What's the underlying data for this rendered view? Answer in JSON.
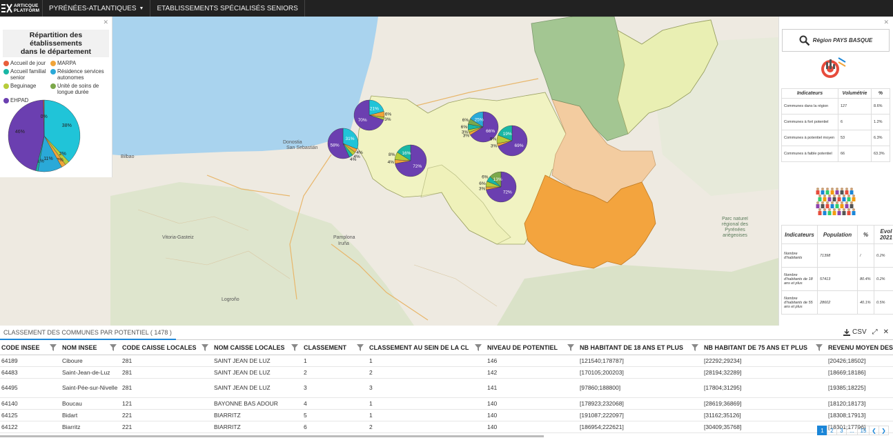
{
  "topbar": {
    "logo_line1": "ARTICQUE",
    "logo_line2": "PLATFORM",
    "dept_menu": "PYRÉNÉES-ATLANTIQUES",
    "module": "ETABLISSEMENTS SPÉCIALISÉS SENIORS"
  },
  "left_panel": {
    "title_line1": "Répartition des établissements",
    "title_line2": "dans le département",
    "legend": [
      {
        "label": "Accueil de jour",
        "color": "#e85f3c"
      },
      {
        "label": "MARPA",
        "color": "#f0a43a"
      },
      {
        "label": "Accueil familial senior",
        "color": "#19b7a5"
      },
      {
        "label": "Résidence services autonomes",
        "color": "#2aa9d8"
      },
      {
        "label": "Beguinage",
        "color": "#b7cc3a"
      },
      {
        "label": "Unité de soins de longue durée",
        "color": "#7ca84a"
      },
      {
        "label": "EHPAD",
        "color": "#6b3fb0"
      }
    ],
    "pie": {
      "slices": [
        {
          "label": "38%",
          "value": 38,
          "color": "#20c4d8"
        },
        {
          "label": "2%",
          "value": 2,
          "color": "#b7cc3a"
        },
        {
          "label": "2%",
          "value": 2,
          "color": "#f0a43a"
        },
        {
          "label": "11%",
          "value": 11,
          "color": "#2aa9d8"
        },
        {
          "label": "1%",
          "value": 1,
          "color": "#19b7a5"
        },
        {
          "label": "46%",
          "value": 46,
          "color": "#6b3fb0"
        },
        {
          "label": "0%",
          "value": 0.4,
          "color": "#e85f3c"
        }
      ]
    }
  },
  "map": {
    "labels": [
      {
        "text": "Donostia",
        "cls": "city"
      },
      {
        "text": "San Sebastián",
        "cls": "city"
      },
      {
        "text": "Pamplona",
        "cls": "city"
      },
      {
        "text": "Iruña",
        "cls": "city"
      },
      {
        "text": "Vitoria-Gasteiz",
        "cls": "city"
      },
      {
        "text": "Bilbao",
        "cls": "city"
      },
      {
        "text": "Logroño",
        "cls": "city"
      },
      {
        "text": "Parc naturel régional des Pyrénées ariégeoises",
        "cls": "park"
      }
    ],
    "pies": [
      {
        "id": "p1",
        "slices": [
          21,
          6,
          3,
          70
        ],
        "labels": [
          "21%",
          "6%",
          "3%",
          "70%"
        ]
      },
      {
        "id": "p2",
        "slices": [
          31,
          4,
          4,
          4,
          57
        ],
        "labels": [
          "31%",
          "4%",
          "4%",
          "4%",
          "58%"
        ]
      },
      {
        "id": "p3",
        "slices": [
          72,
          4,
          8,
          16
        ],
        "labels": [
          "72%",
          "4%",
          "8%",
          "16%"
        ]
      },
      {
        "id": "p4",
        "slices": [
          66,
          3,
          3,
          6,
          6,
          16
        ],
        "labels": [
          "66%",
          "3%",
          "3%",
          "6%",
          "6%",
          "25%"
        ]
      },
      {
        "id": "p5",
        "slices": [
          69,
          3,
          9,
          19
        ],
        "labels": [
          "69%",
          "3%",
          "9%",
          "19%"
        ]
      },
      {
        "id": "p6",
        "slices": [
          72,
          3,
          6,
          6,
          13
        ],
        "labels": [
          "72%",
          "3%",
          "6%",
          "6%",
          "13%"
        ]
      }
    ]
  },
  "right_panel": {
    "region_button": "Région PAYS BASQUE",
    "table1": {
      "headers": [
        "Indicateurs",
        "Volumétrie",
        "%"
      ],
      "rows": [
        [
          "Communes dans la région",
          "127",
          "8.6%"
        ],
        [
          "Communes à fort potentiel",
          "6",
          "1.2%"
        ],
        [
          "Communes à potentiel moyen",
          "53",
          "6.3%"
        ],
        [
          "Communes à faible potentiel",
          "66",
          "63.3%"
        ]
      ]
    },
    "table2": {
      "headers": [
        "Indicateurs",
        "Population",
        "%",
        "Evol 2021"
      ],
      "rows": [
        [
          "Nombre d'habitants",
          "71398",
          "/",
          "0.2%"
        ],
        [
          "Nombre d'habitants de 18 ans et plus",
          "57413",
          "80.4%",
          "0.2%"
        ],
        [
          "Nombre d'habitants de 55 ans et plus",
          "28602",
          "40.1%",
          "0.5%"
        ]
      ]
    }
  },
  "bottom": {
    "title": "CLASSEMENT DES COMMUNES PAR POTENTIEL ( 1478 )",
    "csv_label": "CSV",
    "columns": [
      "CODE INSEE",
      "NOM INSEE",
      "CODE CAISSE LOCALES",
      "NOM CAISSE LOCALES",
      "CLASSEMENT",
      "CLASSEMENT AU SEIN DE LA CL",
      "NIVEAU DE POTENTIEL",
      "NB HABITANT DE 18 ANS ET PLUS",
      "NB HABITANT DE 75 ANS ET PLUS",
      "REVENU MOYEN DES M"
    ],
    "rows": [
      [
        "64189",
        "Ciboure",
        "281",
        "SAINT JEAN DE LUZ",
        "1",
        "1",
        "146",
        "[121540;178787]",
        "[22292;29234]",
        "[20426;18502]"
      ],
      [
        "64483",
        "Saint-Jean-de-Luz",
        "281",
        "SAINT JEAN DE LUZ",
        "2",
        "2",
        "142",
        "[170105;200203]",
        "[28194;32289]",
        "[18669;18186]"
      ],
      [
        "64495",
        "Saint-Pée-sur-Nivelle",
        "281",
        "SAINT JEAN DE LUZ",
        "3",
        "3",
        "141",
        "[97860;188800]",
        "[17804;31295]",
        "[19385;18225]"
      ],
      [
        "64140",
        "Boucau",
        "121",
        "BAYONNE BAS ADOUR",
        "4",
        "1",
        "140",
        "[178923;232068]",
        "[28619;36869]",
        "[18120;18173]"
      ],
      [
        "64125",
        "Bidart",
        "221",
        "BIARRITZ",
        "5",
        "1",
        "140",
        "[191087;222097]",
        "[31162;35126]",
        "[18308;17913]"
      ],
      [
        "64122",
        "Biarritz",
        "221",
        "BIARRITZ",
        "6",
        "2",
        "140",
        "[186954;222621]",
        "[30409;35768]",
        "[18301;17796]"
      ]
    ],
    "pager": [
      "1",
      "2",
      "3",
      "...",
      "15"
    ]
  }
}
